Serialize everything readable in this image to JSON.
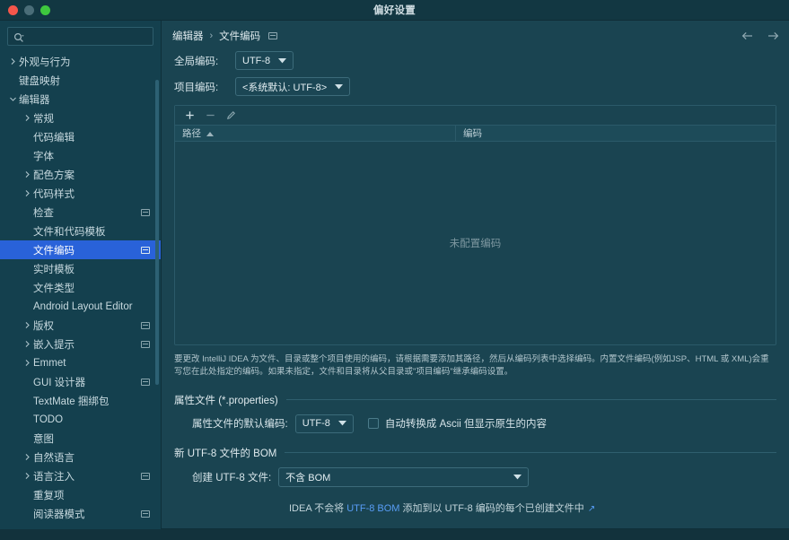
{
  "window": {
    "title": "偏好设置",
    "traffic_lights": [
      "close-button",
      "minimize-button",
      "zoom-button"
    ]
  },
  "sidebar": {
    "search": {
      "value": "",
      "placeholder": "",
      "icon": "search-icon"
    },
    "items": [
      {
        "label": "外观与行为",
        "indent": 0,
        "arrow": "collapsed",
        "badge": false,
        "selected": false
      },
      {
        "label": "键盘映射",
        "indent": 0,
        "arrow": "none",
        "badge": false,
        "selected": false
      },
      {
        "label": "编辑器",
        "indent": 0,
        "arrow": "expanded",
        "badge": false,
        "selected": false
      },
      {
        "label": "常规",
        "indent": 1,
        "arrow": "collapsed",
        "badge": false,
        "selected": false
      },
      {
        "label": "代码编辑",
        "indent": 1,
        "arrow": "none",
        "badge": false,
        "selected": false
      },
      {
        "label": "字体",
        "indent": 1,
        "arrow": "none",
        "badge": false,
        "selected": false
      },
      {
        "label": "配色方案",
        "indent": 1,
        "arrow": "collapsed",
        "badge": false,
        "selected": false
      },
      {
        "label": "代码样式",
        "indent": 1,
        "arrow": "collapsed",
        "badge": false,
        "selected": false
      },
      {
        "label": "检查",
        "indent": 1,
        "arrow": "none",
        "badge": true,
        "selected": false
      },
      {
        "label": "文件和代码模板",
        "indent": 1,
        "arrow": "none",
        "badge": false,
        "selected": false
      },
      {
        "label": "文件编码",
        "indent": 1,
        "arrow": "none",
        "badge": true,
        "selected": true
      },
      {
        "label": "实时模板",
        "indent": 1,
        "arrow": "none",
        "badge": false,
        "selected": false
      },
      {
        "label": "文件类型",
        "indent": 1,
        "arrow": "none",
        "badge": false,
        "selected": false
      },
      {
        "label": "Android Layout Editor",
        "indent": 1,
        "arrow": "none",
        "badge": false,
        "selected": false
      },
      {
        "label": "版权",
        "indent": 1,
        "arrow": "collapsed",
        "badge": true,
        "selected": false
      },
      {
        "label": "嵌入提示",
        "indent": 1,
        "arrow": "collapsed",
        "badge": true,
        "selected": false
      },
      {
        "label": "Emmet",
        "indent": 1,
        "arrow": "collapsed",
        "badge": false,
        "selected": false
      },
      {
        "label": "GUI 设计器",
        "indent": 1,
        "arrow": "none",
        "badge": true,
        "selected": false
      },
      {
        "label": "TextMate 捆绑包",
        "indent": 1,
        "arrow": "none",
        "badge": false,
        "selected": false
      },
      {
        "label": "TODO",
        "indent": 1,
        "arrow": "none",
        "badge": false,
        "selected": false
      },
      {
        "label": "意图",
        "indent": 1,
        "arrow": "none",
        "badge": false,
        "selected": false
      },
      {
        "label": "自然语言",
        "indent": 1,
        "arrow": "collapsed",
        "badge": false,
        "selected": false
      },
      {
        "label": "语言注入",
        "indent": 1,
        "arrow": "collapsed",
        "badge": true,
        "selected": false
      },
      {
        "label": "重复项",
        "indent": 1,
        "arrow": "none",
        "badge": false,
        "selected": false
      },
      {
        "label": "阅读器模式",
        "indent": 1,
        "arrow": "none",
        "badge": true,
        "selected": false
      }
    ]
  },
  "breadcrumb": {
    "parent": "编辑器",
    "separator": "›",
    "current": "文件编码",
    "badge_icon": "project-scope-icon",
    "back_icon": "arrow-left-icon",
    "forward_icon": "arrow-right-icon"
  },
  "main": {
    "global_encoding": {
      "label": "全局编码:",
      "value": "UTF-8"
    },
    "project_encoding": {
      "label": "项目编码:",
      "value": "<系统默认: UTF-8>"
    },
    "table": {
      "toolbar": [
        {
          "name": "add-button",
          "glyph": "+"
        },
        {
          "name": "remove-button",
          "glyph": "−"
        },
        {
          "name": "edit-button",
          "glyph": "pencil"
        }
      ],
      "columns": [
        "路径",
        "编码"
      ],
      "sort_indicator": "▲",
      "empty_text": "未配置编码",
      "rows": []
    },
    "help_text": "要更改 IntelliJ IDEA 为文件、目录或整个项目使用的编码，请根据需要添加其路径，然后从编码列表中选择编码。内置文件编码(例如JSP、HTML 或 XML)会重写您在此处指定的编码。如果未指定，文件和目录将从父目录或\"项目编码\"继承编码设置。",
    "properties_section": {
      "title": "属性文件 (*.properties)",
      "default_encoding_label": "属性文件的默认编码:",
      "default_encoding_value": "UTF-8",
      "transparent_checkbox": {
        "label": "自动转换成 Ascii 但显示原生的内容",
        "checked": false
      }
    },
    "bom_section": {
      "title": "新 UTF-8 文件的 BOM",
      "create_label": "创建 UTF-8 文件:",
      "create_value": "不含 BOM",
      "note_prefix": "IDEA 不会将 ",
      "note_link": "UTF-8 BOM",
      "note_suffix": " 添加到以 UTF-8 编码的每个已创建文件中",
      "note_external_icon": "↗"
    }
  },
  "colors": {
    "window_bg": "#1a4451",
    "sidebar_bg": "#14404e",
    "titlebar_bg": "#123742",
    "selection_blue": "#2962d9",
    "link_blue": "#589df6",
    "border": "#2b5a69",
    "text_primary": "#d6e4e9",
    "text_muted": "#7d97a0"
  }
}
